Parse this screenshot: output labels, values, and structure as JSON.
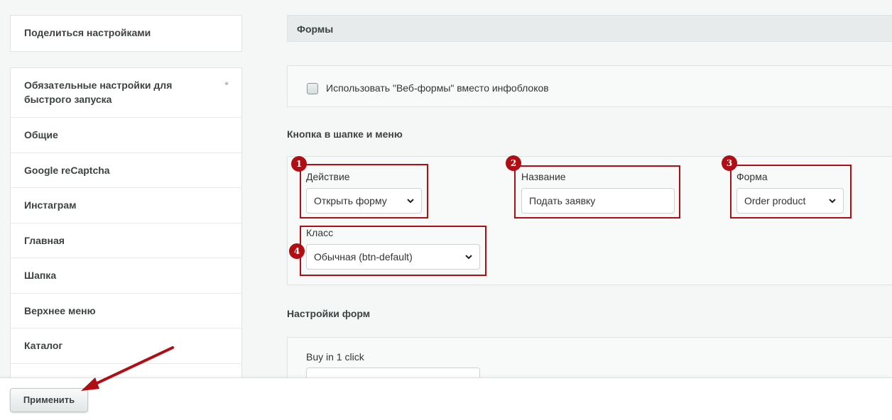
{
  "sidebar": {
    "share_label": "Поделиться настройками",
    "items": [
      {
        "label": "Обязательные настройки для быстрого запуска",
        "starred": true
      },
      {
        "label": "Общие"
      },
      {
        "label": "Google reCaptcha"
      },
      {
        "label": "Инстаграм"
      },
      {
        "label": "Главная"
      },
      {
        "label": "Шапка"
      },
      {
        "label": "Верхнее меню"
      },
      {
        "label": "Каталог"
      }
    ],
    "star_glyph": "*"
  },
  "main": {
    "section_title": "Формы",
    "webforms_checkbox_label": "Использовать \"Веб-формы\" вместо инфоблоков",
    "webforms_checked": false,
    "header_button_heading": "Кнопка в шапке и меню",
    "fields": {
      "action": {
        "label": "Действие",
        "value": "Открыть форму",
        "marker": "1"
      },
      "name": {
        "label": "Название",
        "value": "Подать заявку",
        "marker": "2"
      },
      "form": {
        "label": "Форма",
        "value": "Order product",
        "marker": "3"
      },
      "class": {
        "label": "Класс",
        "value": "Обычная (btn-default)",
        "marker": "4"
      }
    },
    "form_settings_heading": "Настройки форм",
    "buy_one_click_label": "Buy in 1 click"
  },
  "footer": {
    "apply_label": "Применить"
  },
  "colors": {
    "annotation_red": "#b00d14",
    "page_bg": "#f5f7f7"
  },
  "icons": {
    "select_arrow": "chevron-down-icon",
    "annotation_arrow": "arrow-icon"
  }
}
